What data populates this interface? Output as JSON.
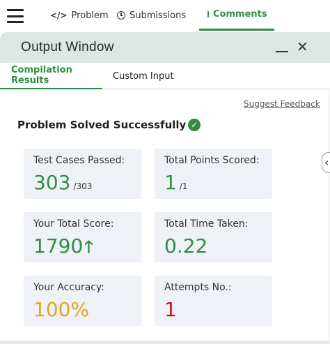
{
  "nav": {
    "tabs": [
      {
        "label": "Problem",
        "icon": "code-icon"
      },
      {
        "label": "Submissions",
        "icon": "clock-icon"
      },
      {
        "label": "Comments",
        "icon": "comment-icon"
      }
    ],
    "active_tab": "Comments",
    "code_glyph": "</>"
  },
  "window": {
    "title": "Output Window",
    "close_glyph": "✕"
  },
  "subtabs": {
    "items": [
      "Compilation Results",
      "Custom Input"
    ],
    "active": "Compilation Results"
  },
  "content": {
    "suggest_feedback": "Suggest Feedback",
    "status": "Problem Solved Successfully",
    "check_glyph": "✓",
    "cards": {
      "test_cases": {
        "label": "Test Cases Passed:",
        "value": "303",
        "sub": "/303"
      },
      "total_points": {
        "label": "Total Points Scored:",
        "value": "1",
        "sub": "/1"
      },
      "total_score": {
        "label": "Your Total Score:",
        "value": "1790",
        "trend_glyph": "🡑"
      },
      "time_taken": {
        "label": "Total Time Taken:",
        "value": "0.22"
      },
      "accuracy": {
        "label": "Your Accuracy:",
        "value": "100%"
      },
      "attempts": {
        "label": "Attempts No.:",
        "value": "1"
      }
    }
  },
  "colors": {
    "accent_green": "#2f8d46",
    "accuracy_orange": "#e3a51f",
    "attempts_red": "#c4161c",
    "card_bg": "#eef1f6",
    "header_bg": "#dde6e2"
  }
}
